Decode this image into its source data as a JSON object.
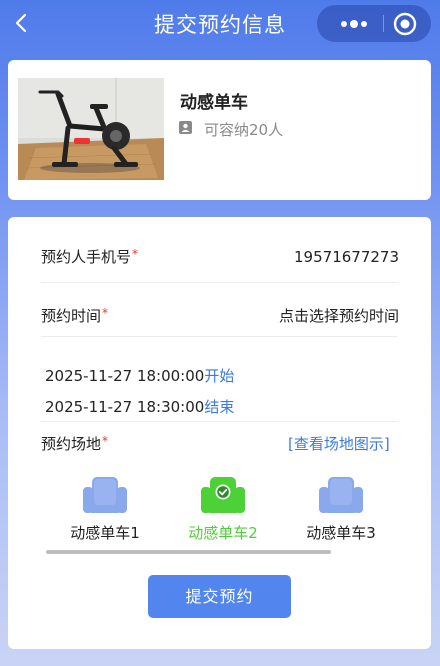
{
  "nav": {
    "title": "提交预约信息"
  },
  "product": {
    "name": "动感单车",
    "capacity": "可容纳20人"
  },
  "form": {
    "phone_label": "预约人手机号",
    "phone_value": "19571677273",
    "time_label": "预约时间",
    "time_value": "点击选择预约时间",
    "start_time": "2025-11-27 18:00:00",
    "start_tag": "开始",
    "end_time": "2025-11-27 18:30:00",
    "end_tag": "结束",
    "venue_label": "预约场地",
    "venue_link": "[查看场地图示]",
    "required_mark": "*"
  },
  "venues": [
    {
      "label": "动感单车1",
      "selected": false
    },
    {
      "label": "动感单车2",
      "selected": true
    },
    {
      "label": "动感单车3",
      "selected": false
    }
  ],
  "colors": {
    "accent": "#5286ee",
    "selected": "#4cd137",
    "seat_idle": "#8aa8ec",
    "required": "#ee3333"
  },
  "submit_label": "提交预约"
}
